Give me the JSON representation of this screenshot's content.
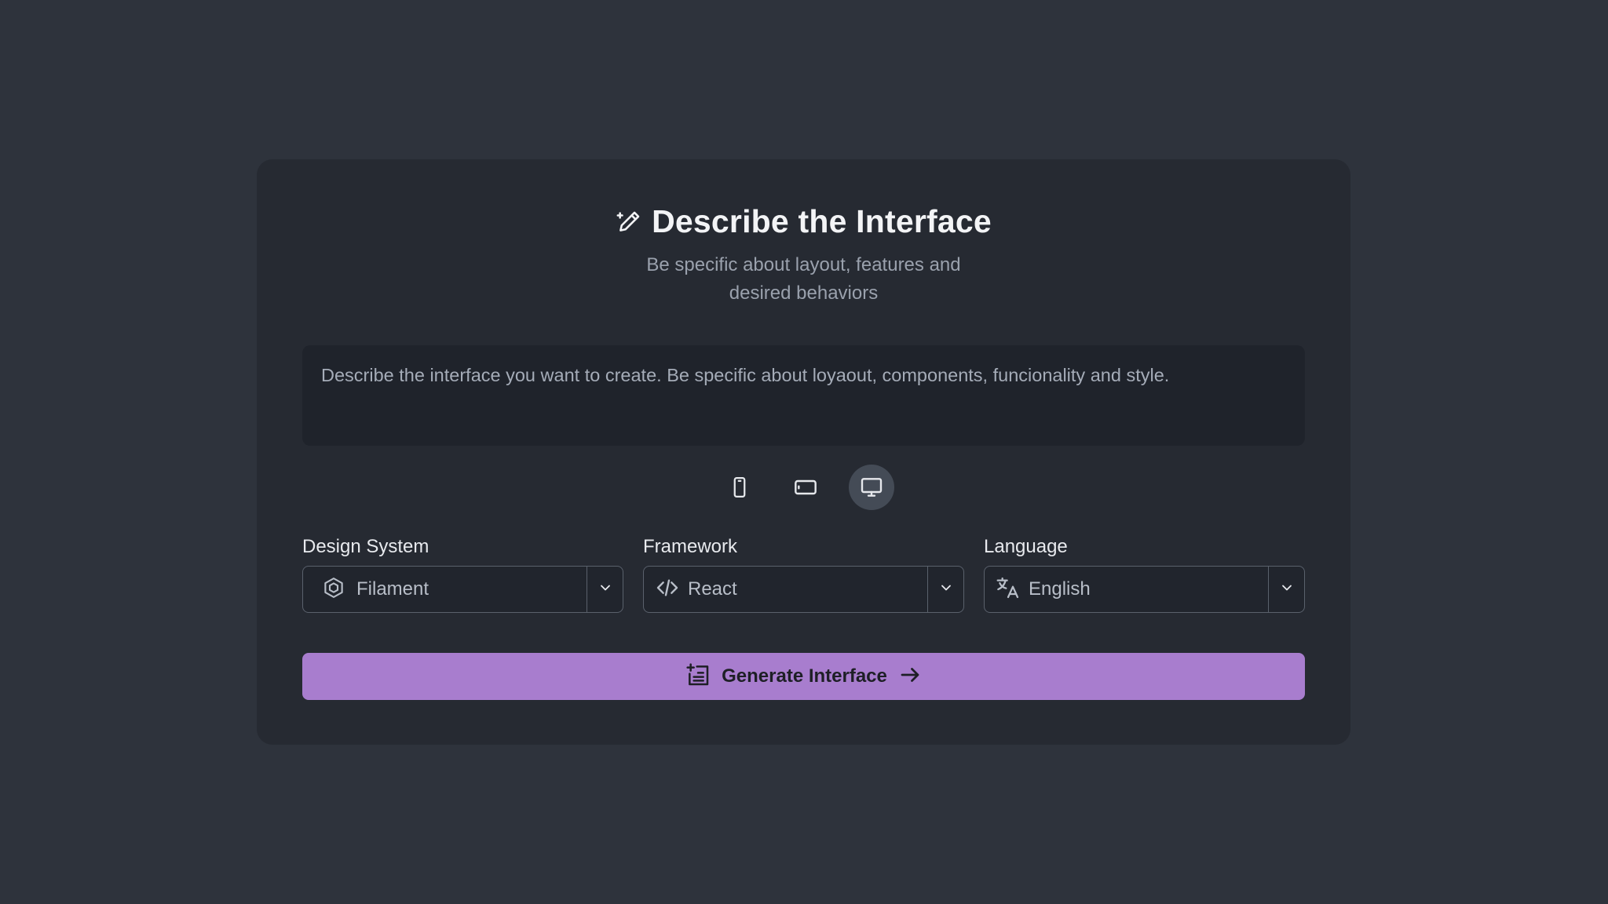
{
  "header": {
    "icon": "magic-pencil-icon",
    "title": "Describe the Interface",
    "subtitle": "Be specific about layout, features and desired behaviors"
  },
  "prompt": {
    "value": "Describe the interface you want to create. Be specific about loyaout, components, funcionality and style."
  },
  "devices": [
    {
      "name": "mobile",
      "icon": "smartphone-icon",
      "active": false
    },
    {
      "name": "tablet",
      "icon": "tablet-landscape-icon",
      "active": false
    },
    {
      "name": "desktop",
      "icon": "monitor-icon",
      "active": true
    }
  ],
  "selectors": {
    "design_system": {
      "label": "Design System",
      "value": "Filament",
      "icon": "hexagon-box-icon"
    },
    "framework": {
      "label": "Framework",
      "value": "React",
      "icon": "code-icon"
    },
    "language": {
      "label": "Language",
      "value": "English",
      "icon": "translate-icon"
    }
  },
  "generate": {
    "label": "Generate Interface",
    "icon": "add-layout-icon",
    "trailing_icon": "arrow-right-icon"
  },
  "colors": {
    "page_bg": "#2e333c",
    "card_bg": "#262a32",
    "input_bg": "#1f232b",
    "accent": "#a87dce",
    "active_device_bg": "#444b56"
  }
}
